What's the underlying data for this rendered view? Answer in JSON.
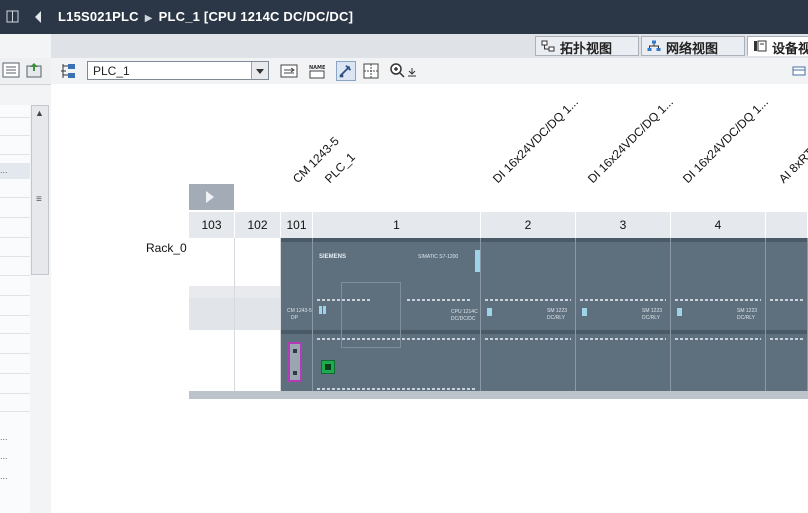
{
  "window": {
    "title_project": "L15S021PLC",
    "title_device": "PLC_1 [CPU 1214C DC/DC/DC]"
  },
  "views": [
    {
      "label": "拓扑视图"
    },
    {
      "label": "网络视图"
    },
    {
      "label": "设备视"
    }
  ],
  "toolbar": {
    "device_selected": "PLC_1"
  },
  "modules": [
    {
      "label": "CM 1243-5"
    },
    {
      "label": "PLC_1"
    },
    {
      "label": "DI 16x24VDC/DQ 1..."
    },
    {
      "label": "DI 16x24VDC/DQ 1..."
    },
    {
      "label": "DI 16x24VDC/DQ 1..."
    },
    {
      "label": "AI 8xRT"
    }
  ],
  "rack": {
    "name": "Rack_0",
    "slots": [
      "103",
      "102",
      "101",
      "1",
      "2",
      "3",
      "4"
    ]
  },
  "module_text": {
    "brand": "SIEMENS",
    "cpu_model": "SIMATIC S7-1200",
    "cpu_text": "CPU 1214C",
    "cpu_sub": "DC/DC/DC",
    "sm_text": "SM 1223",
    "sm_sub": "DC/RLY",
    "cm_text": "CM 1243-5",
    "cm_sub": "DP"
  },
  "colors": {
    "titlebar": "#2b3746",
    "module": "#5e6f7d",
    "connector_highlight": "#b33ab8",
    "ethernet_port": "#1faa4f"
  },
  "icons": [
    "split-icon",
    "back-arrow-icon",
    "topology-icon",
    "network-icon",
    "device-icon",
    "zoom-icon",
    "grid-icon"
  ]
}
